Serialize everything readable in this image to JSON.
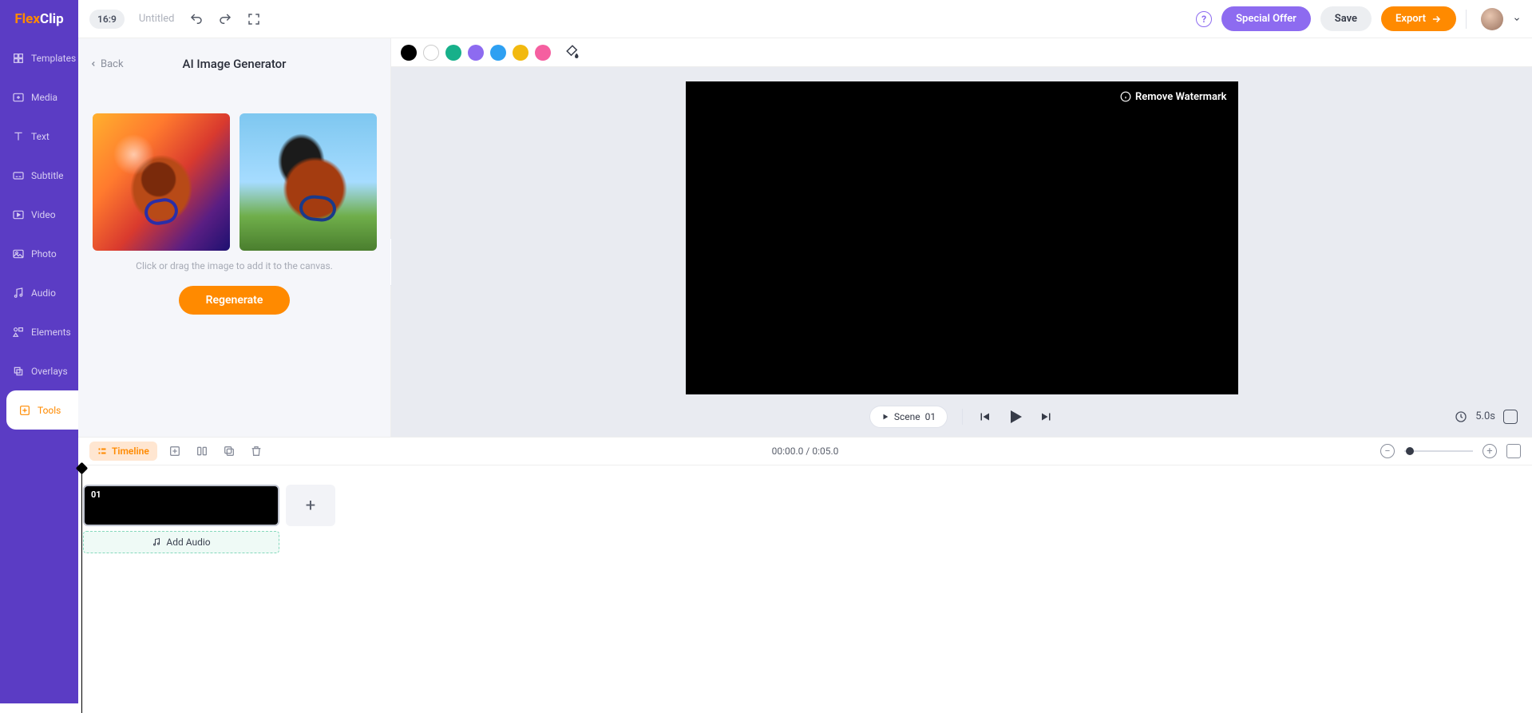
{
  "logo": {
    "brand1": "Flex",
    "brand2": "Clip"
  },
  "sidebar": [
    {
      "id": "templates",
      "label": "Templates"
    },
    {
      "id": "media",
      "label": "Media"
    },
    {
      "id": "text",
      "label": "Text"
    },
    {
      "id": "subtitle",
      "label": "Subtitle"
    },
    {
      "id": "video",
      "label": "Video"
    },
    {
      "id": "photo",
      "label": "Photo"
    },
    {
      "id": "audio",
      "label": "Audio"
    },
    {
      "id": "elements",
      "label": "Elements"
    },
    {
      "id": "overlays",
      "label": "Overlays"
    },
    {
      "id": "tools",
      "label": "Tools"
    }
  ],
  "topbar": {
    "ratio": "16:9",
    "title": "Untitled",
    "special_offer": "Special Offer",
    "save": "Save",
    "export": "Export"
  },
  "panel": {
    "back": "Back",
    "title": "AI Image Generator",
    "hint": "Click or drag the image to add it to the canvas.",
    "regenerate": "Regenerate"
  },
  "colors": [
    "#000000",
    "outline",
    "#17b08a",
    "#8d6bf0",
    "#2ea0f2",
    "#f2b90f",
    "#f55fa0"
  ],
  "canvas": {
    "watermark": "Remove Watermark",
    "scene_label": "Scene",
    "scene_num": "01",
    "duration": "5.0s"
  },
  "timeline": {
    "tab": "Timeline",
    "time": "00:00.0 / 0:05.0",
    "scene_num": "01",
    "add_audio": "Add Audio"
  }
}
